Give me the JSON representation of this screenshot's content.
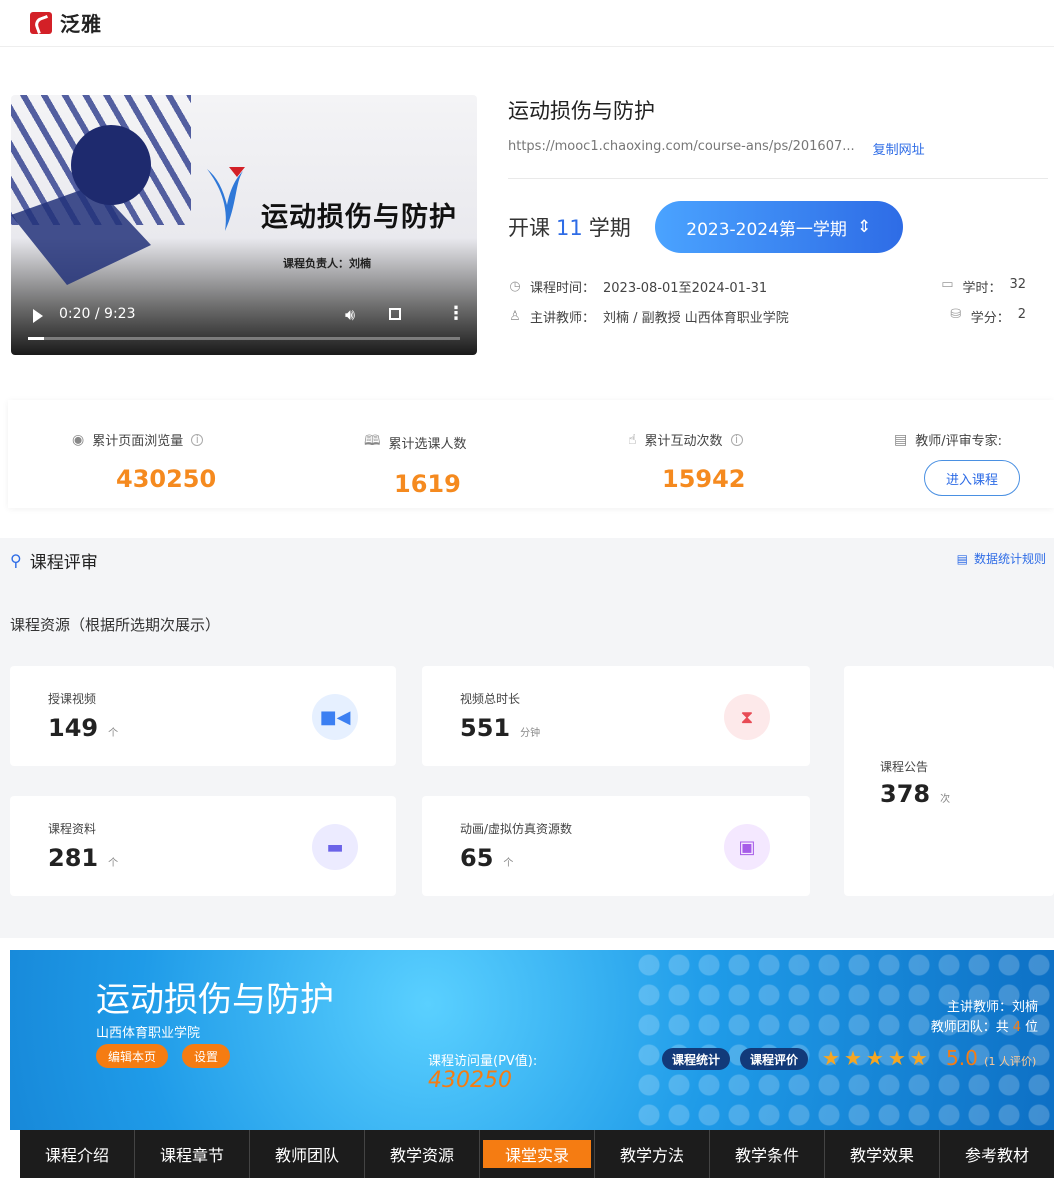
{
  "brand": {
    "name": "泛雅"
  },
  "video": {
    "overlay_title": "运动损伤与防护",
    "overlay_subtitle": "课程负责人：刘楠",
    "time": "0:20 / 9:23",
    "progress": 0.036
  },
  "course": {
    "title": "运动损伤与防护",
    "url": "https://mooc1.chaoxing.com/course-ans/ps/201607...",
    "copy_label": "复制网址",
    "term_prefix": "开课",
    "term_count": "11",
    "term_suffix": "学期",
    "term_selected": "2023-2024第一学期",
    "time_label": "课程时间：",
    "time_value": "2023-08-01至2024-01-31",
    "hours_label": "学时：",
    "hours_value": "32",
    "teacher_label": "主讲教师：",
    "teacher_value": "刘楠 / 副教授 山西体育职业学院",
    "credit_label": "学分：",
    "credit_value": "2"
  },
  "stats": {
    "views_label": "累计页面浏览量",
    "views_value": "430250",
    "enroll_label": "累计选课人数",
    "enroll_value": "1619",
    "interact_label": "累计互动次数",
    "interact_value": "15942",
    "expert_label": "教师/评审专家:",
    "enter_label": "进入课程"
  },
  "review": {
    "title": "课程评审",
    "rule_link": "数据统计规则",
    "resource_title": "课程资源（根据所选期次展示）",
    "cards": [
      {
        "label": "授课视频",
        "value": "149",
        "unit": "个"
      },
      {
        "label": "视频总时长",
        "value": "551",
        "unit": "分钟"
      },
      {
        "label": "课程资料",
        "value": "281",
        "unit": "个"
      },
      {
        "label": "动画/虚拟仿真资源数",
        "value": "65",
        "unit": "个"
      },
      {
        "label": "课程公告",
        "value": "378",
        "unit": "次"
      }
    ]
  },
  "banner": {
    "title": "运动损伤与防护",
    "school": "山西体育职业学院",
    "edit_label": "编辑本页",
    "settings_label": "设置",
    "pv_label": "课程访问量(PV值):",
    "pv_value": "430250",
    "stats_pill": "课程统计",
    "eval_pill": "课程评价",
    "rating": 5,
    "score": "5.0",
    "score_note": "(1 人评价)",
    "teacher_line": "主讲教师：刘楠",
    "team_prefix": "教师团队：共",
    "team_count": "4",
    "team_suffix": "位"
  },
  "nav": {
    "items": [
      "课程介绍",
      "课程章节",
      "教师团队",
      "教学资源",
      "课堂实录",
      "教学方法",
      "教学条件",
      "教学效果",
      "参考教材"
    ],
    "active_index": 4
  },
  "colors": {
    "accent_blue": "#2e6ce6",
    "accent_orange": "#f58a1f"
  }
}
